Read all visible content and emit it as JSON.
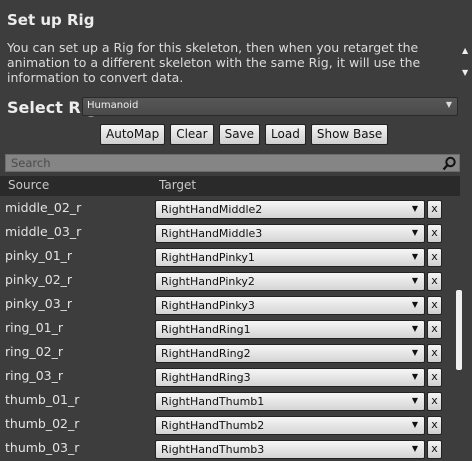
{
  "panel": {
    "title": "Set up Rig",
    "description": "You can set up a Rig for this skeleton, then when you retarget the animation to a different skeleton with the same Rig, it will use the information to convert data."
  },
  "rig": {
    "label": "Select Rig",
    "selected": "Humanoid"
  },
  "buttons": {
    "automap": "AutoMap",
    "clear": "Clear",
    "save": "Save",
    "load": "Load",
    "show_base": "Show Base"
  },
  "search": {
    "placeholder": "Search"
  },
  "table": {
    "headers": {
      "source": "Source",
      "target": "Target"
    },
    "clear_label": "x",
    "rows": [
      {
        "source": "middle_02_r",
        "target": "RightHandMiddle2"
      },
      {
        "source": "middle_03_r",
        "target": "RightHandMiddle3"
      },
      {
        "source": "pinky_01_r",
        "target": "RightHandPinky1"
      },
      {
        "source": "pinky_02_r",
        "target": "RightHandPinky2"
      },
      {
        "source": "pinky_03_r",
        "target": "RightHandPinky3"
      },
      {
        "source": "ring_01_r",
        "target": "RightHandRing1"
      },
      {
        "source": "ring_02_r",
        "target": "RightHandRing2"
      },
      {
        "source": "ring_03_r",
        "target": "RightHandRing3"
      },
      {
        "source": "thumb_01_r",
        "target": "RightHandThumb1"
      },
      {
        "source": "thumb_02_r",
        "target": "RightHandThumb2"
      },
      {
        "source": "thumb_03_r",
        "target": "RightHandThumb3"
      }
    ]
  },
  "icons": {
    "search": "magnifier-icon",
    "dropdown": "triangle-down-icon"
  }
}
